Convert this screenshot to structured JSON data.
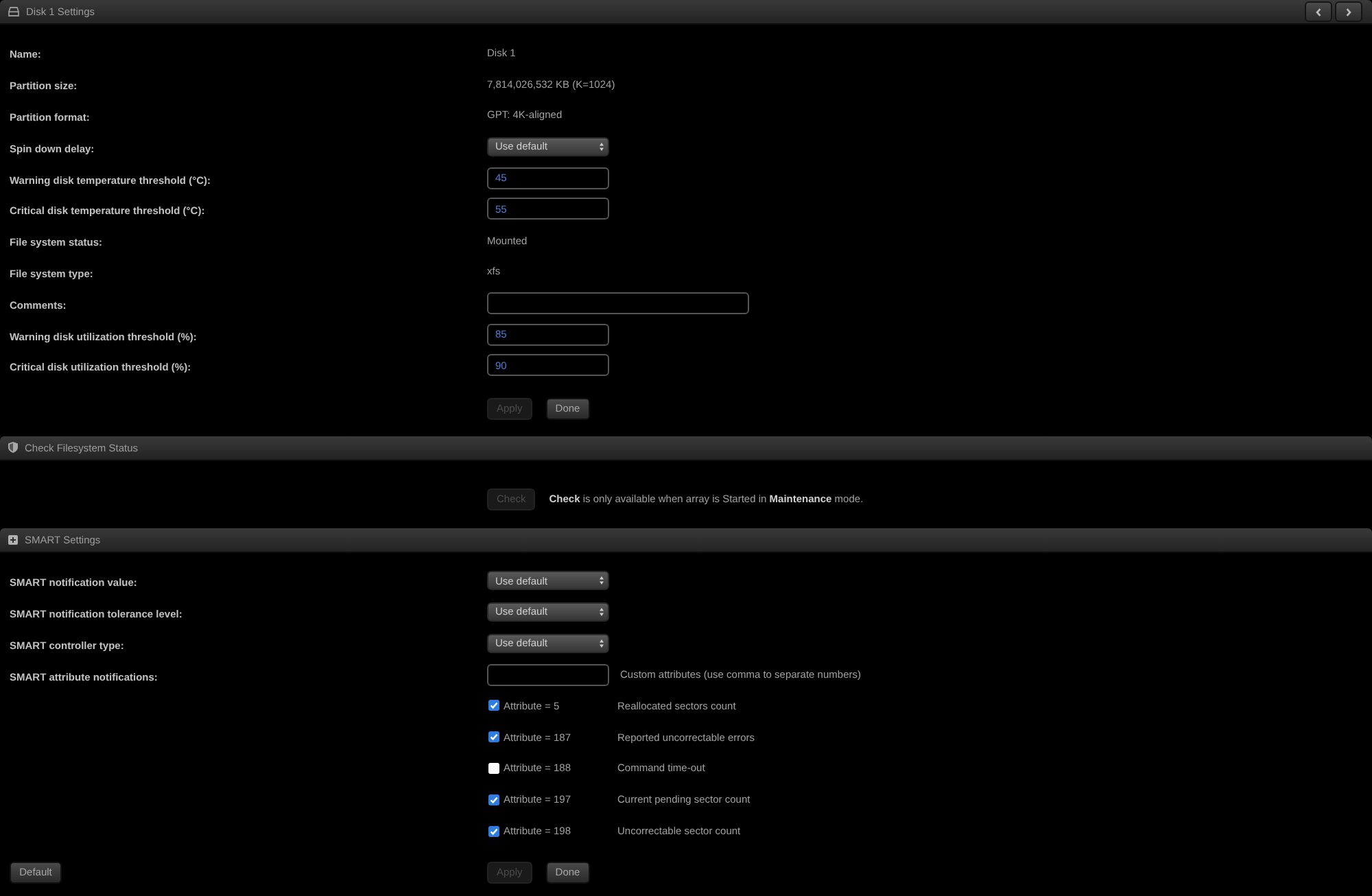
{
  "disk_settings": {
    "title": "Disk 1 Settings",
    "rows": [
      {
        "label": "Name:",
        "kind": "static",
        "value": "Disk 1"
      },
      {
        "label": "Partition size:",
        "kind": "static",
        "value": "7,814,026,532 KB (K=1024)"
      },
      {
        "label": "Partition format:",
        "kind": "static",
        "value": "GPT: 4K-aligned"
      },
      {
        "label": "Spin down delay:",
        "kind": "select",
        "value": "Use default"
      },
      {
        "label": "Warning disk temperature threshold (°C):",
        "kind": "number",
        "value": "45"
      },
      {
        "label": "Critical disk temperature threshold (°C):",
        "kind": "number",
        "value": "55"
      },
      {
        "label": "File system status:",
        "kind": "static",
        "value": "Mounted"
      },
      {
        "label": "File system type:",
        "kind": "static",
        "value": "xfs"
      },
      {
        "label": "Comments:",
        "kind": "textbox"
      },
      {
        "label": "Warning disk utilization threshold (%):",
        "kind": "number",
        "value": "85"
      },
      {
        "label": "Critical disk utilization threshold (%):",
        "kind": "number",
        "value": "90"
      }
    ],
    "buttons": [
      {
        "label": "Apply",
        "disabled": true
      },
      {
        "label": "Done",
        "disabled": false
      }
    ]
  },
  "check_filesystem": {
    "title": "Check Filesystem Status",
    "button": {
      "label": "Check",
      "disabled": true
    },
    "note": "**Check** is only available when array is Started in **Maintenance** mode."
  },
  "smart_settings": {
    "title": "SMART Settings",
    "rows": [
      {
        "label": "SMART notification value:",
        "kind": "select",
        "value": "Use default"
      },
      {
        "label": "SMART notification tolerance level:",
        "kind": "select",
        "value": "Use default"
      },
      {
        "label": "SMART controller type:",
        "kind": "select",
        "value": "Use default"
      },
      {
        "label": "SMART attribute notifications:",
        "kind": "number",
        "note": "Custom attributes (use comma to separate numbers)"
      }
    ],
    "attributes": [
      {
        "label": "Attribute = 5",
        "checked": true,
        "description": "Reallocated sectors count"
      },
      {
        "label": "Attribute = 187",
        "checked": true,
        "description": "Reported uncorrectable errors"
      },
      {
        "label": "Attribute = 188",
        "checked": false,
        "description": "Command time-out"
      },
      {
        "label": "Attribute = 197",
        "checked": true,
        "description": "Current pending sector count"
      },
      {
        "label": "Attribute = 198",
        "checked": true,
        "description": "Uncorrectable sector count"
      }
    ],
    "default_button": {
      "label": "Default",
      "disabled": false
    },
    "buttons": [
      {
        "label": "Apply",
        "disabled": true
      },
      {
        "label": "Done",
        "disabled": false
      }
    ]
  }
}
